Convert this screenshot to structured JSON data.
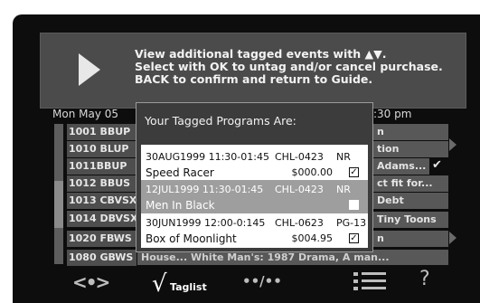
{
  "header": {
    "line1": "View additional tagged events with ▲▼.",
    "line2": "Select with OK to untag and/or cancel purchase.",
    "line3": "BACK to confirm and return to Guide."
  },
  "guide": {
    "date": "Mon May 05",
    "time_right": ":30 pm",
    "channels": [
      "1001 BBUP",
      "1010 BLUP",
      "1011BBUP",
      "1012 BBUS",
      "1013 CBVSX",
      "1014 DBVSX",
      "1020 FBWS",
      "1080 GBWS"
    ],
    "right_programs": [
      "n",
      "tion",
      "Adams...",
      "ct fit for...",
      "Debt",
      "Tiny Toons",
      "n"
    ],
    "bottom_program": "House...     White Man's: 1987 Drama, A man..."
  },
  "popup": {
    "title": "Your Tagged Programs Are:",
    "entries": [
      {
        "date": "30AUG1999 11:30-01:45",
        "channel": "CHL-0423",
        "rating": "NR",
        "title": "Speed Racer",
        "price": "$000.00",
        "checked": "☑"
      },
      {
        "date": "12JUL1999 11:30-01:45",
        "channel": "CHL-0423",
        "rating": "NR",
        "title": "Men In Black",
        "price": "",
        "checked": ""
      },
      {
        "date": "30JUN1999 12:00-0:145",
        "channel": "CHL-0623",
        "rating": "PG-13",
        "title": "Box of Moonlight",
        "price": "$004.95",
        "checked": "☑"
      }
    ]
  },
  "bottom_bar": {
    "nav": "<•>",
    "taglist_check": "√",
    "taglist": "Taglist",
    "page": "••/••",
    "help": "?"
  },
  "icons": [
    "play-icon",
    "nav-arrows-icon",
    "check-icon",
    "page-icon",
    "list-icon",
    "help-icon"
  ]
}
